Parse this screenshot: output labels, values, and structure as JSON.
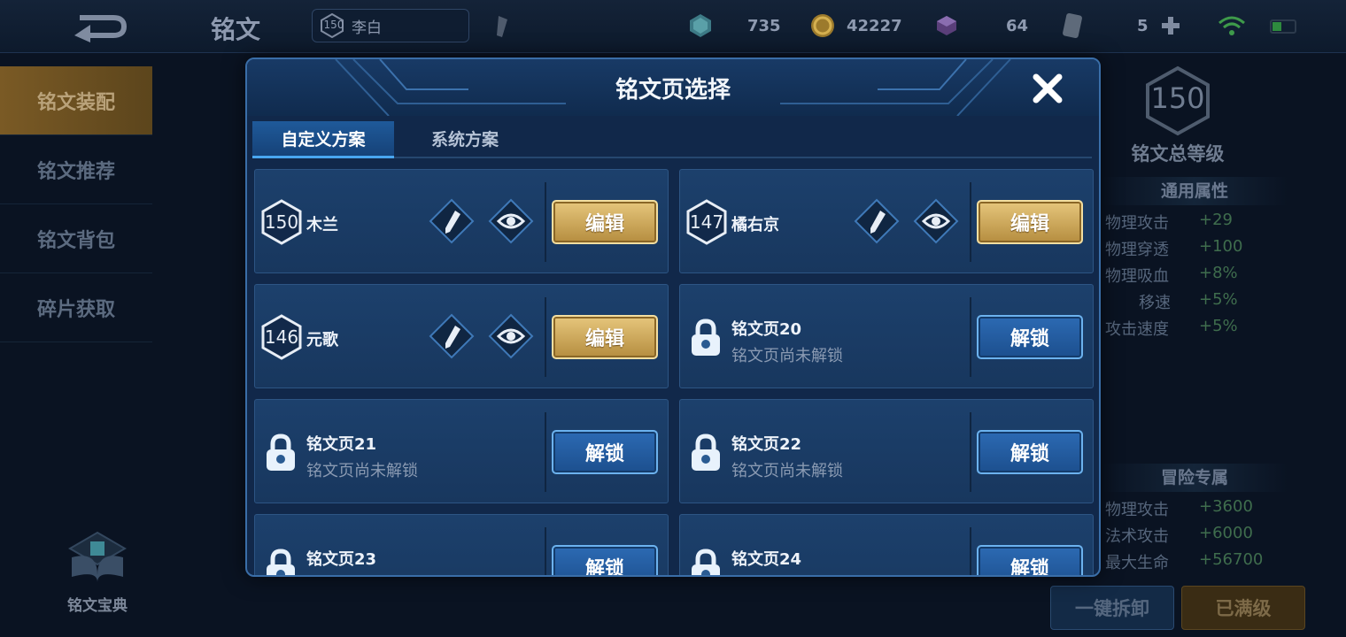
{
  "topbar": {
    "title": "铭文",
    "hero": {
      "level": "150",
      "name": "李白"
    },
    "resources": [
      {
        "icon": "diamond-icon",
        "value": "735"
      },
      {
        "icon": "gold-coin-icon",
        "value": "42227"
      },
      {
        "icon": "crystal-icon",
        "value": "64"
      },
      {
        "icon": "card-icon",
        "value": "5"
      }
    ]
  },
  "sidebar": {
    "items": [
      {
        "label": "铭文装配"
      },
      {
        "label": "铭文推荐"
      },
      {
        "label": "铭文背包"
      },
      {
        "label": "碎片获取"
      }
    ],
    "codex_label": "铭文宝典"
  },
  "right_panel": {
    "level": "150",
    "level_label": "铭文总等级",
    "general_title": "通用属性",
    "general_attrs": [
      {
        "name": "物理攻击",
        "value": "+29"
      },
      {
        "name": "物理穿透",
        "value": "+100"
      },
      {
        "name": "物理吸血",
        "value": "+8%"
      },
      {
        "name": "移速",
        "value": "+5%"
      },
      {
        "name": "攻击速度",
        "value": "+5%"
      }
    ],
    "adventure_title": "冒险专属",
    "adventure_attrs": [
      {
        "name": "物理攻击",
        "value": "+3600"
      },
      {
        "name": "法术攻击",
        "value": "+6000"
      },
      {
        "name": "最大生命",
        "value": "+56700"
      }
    ],
    "unload_button": "一键拆卸",
    "maxed_button": "已满级"
  },
  "dialog": {
    "title": "铭文页选择",
    "tabs": [
      {
        "label": "自定义方案"
      },
      {
        "label": "系统方案"
      }
    ],
    "edit_label": "编辑",
    "unlock_label": "解锁",
    "locked_subtitle": "铭文页尚未解锁",
    "pages": [
      {
        "level": "150",
        "name": "木兰"
      },
      {
        "level": "147",
        "name": "橘右京"
      },
      {
        "level": "146",
        "name": "元歌"
      },
      {
        "name": "铭文页20"
      },
      {
        "name": "铭文页21"
      },
      {
        "name": "铭文页22"
      },
      {
        "name": "铭文页23"
      },
      {
        "name": "铭文页24"
      }
    ]
  }
}
